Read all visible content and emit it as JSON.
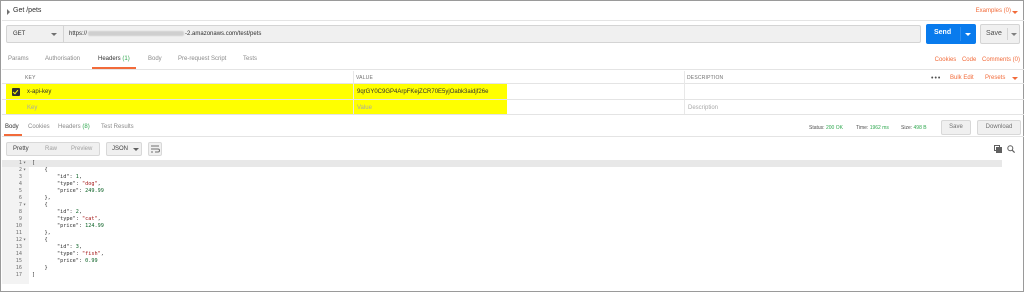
{
  "request": {
    "title": "Get /pets",
    "examples_label": "Examples (0)",
    "method": "GET",
    "url_prefix": "https://",
    "url_suffix": "-2.amazonaws.com/test/pets",
    "send_label": "Send",
    "save_label": "Save"
  },
  "request_tabs": [
    {
      "label": "Params",
      "count": ""
    },
    {
      "label": "Authorisation",
      "count": ""
    },
    {
      "label": "Headers",
      "count": "(1)"
    },
    {
      "label": "Body",
      "count": ""
    },
    {
      "label": "Pre-request Script",
      "count": ""
    },
    {
      "label": "Tests",
      "count": ""
    }
  ],
  "request_links": {
    "cookies": "Cookies",
    "code": "Code",
    "comments": "Comments (0)"
  },
  "headers_table": {
    "columns": {
      "key": "KEY",
      "value": "VALUE",
      "description": "DESCRIPTION"
    },
    "bulk_edit": "Bulk Edit",
    "presets": "Presets",
    "rows": [
      {
        "checked": true,
        "key": "x-api-key",
        "value": "9qrGY0C9GP4ArpFKejZCR70E5yjOabk3aidjf26e",
        "description": ""
      }
    ],
    "placeholders": {
      "key": "Key",
      "value": "Value",
      "description": "Description"
    }
  },
  "response_tabs": [
    {
      "label": "Body",
      "count": ""
    },
    {
      "label": "Cookies",
      "count": ""
    },
    {
      "label": "Headers",
      "count": "(8)"
    },
    {
      "label": "Test Results",
      "count": ""
    }
  ],
  "response_meta": {
    "status_label": "Status:",
    "status_value": "200 OK",
    "time_label": "Time:",
    "time_value": "1962 ms",
    "size_label": "Size:",
    "size_value": "498 B",
    "save_label": "Save",
    "download_label": "Download"
  },
  "response_view": {
    "modes": [
      "Pretty",
      "Raw",
      "Preview"
    ],
    "active_mode": "Pretty",
    "format": "JSON"
  },
  "response_body": {
    "lines": [
      {
        "n": "1",
        "fold": "▾",
        "text": "["
      },
      {
        "n": "2",
        "fold": "▾",
        "text": "    {"
      },
      {
        "n": "3",
        "fold": "",
        "text": "        \"id\": 1,"
      },
      {
        "n": "4",
        "fold": "",
        "text": "        \"type\": \"dog\","
      },
      {
        "n": "5",
        "fold": "",
        "text": "        \"price\": 249.99"
      },
      {
        "n": "6",
        "fold": "",
        "text": "    },"
      },
      {
        "n": "7",
        "fold": "▾",
        "text": "    {"
      },
      {
        "n": "8",
        "fold": "",
        "text": "        \"id\": 2,"
      },
      {
        "n": "9",
        "fold": "",
        "text": "        \"type\": \"cat\","
      },
      {
        "n": "10",
        "fold": "",
        "text": "        \"price\": 124.99"
      },
      {
        "n": "11",
        "fold": "",
        "text": "    },"
      },
      {
        "n": "12",
        "fold": "▾",
        "text": "    {"
      },
      {
        "n": "13",
        "fold": "",
        "text": "        \"id\": 3,"
      },
      {
        "n": "14",
        "fold": "",
        "text": "        \"type\": \"fish\","
      },
      {
        "n": "15",
        "fold": "",
        "text": "        \"price\": 0.99"
      },
      {
        "n": "16",
        "fold": "",
        "text": "    }"
      },
      {
        "n": "17",
        "fold": "",
        "text": "]"
      }
    ]
  },
  "colors": {
    "accent": "#f26b3a",
    "send": "#097bed",
    "highlight": "#ffff00",
    "success": "#2fa84f"
  }
}
